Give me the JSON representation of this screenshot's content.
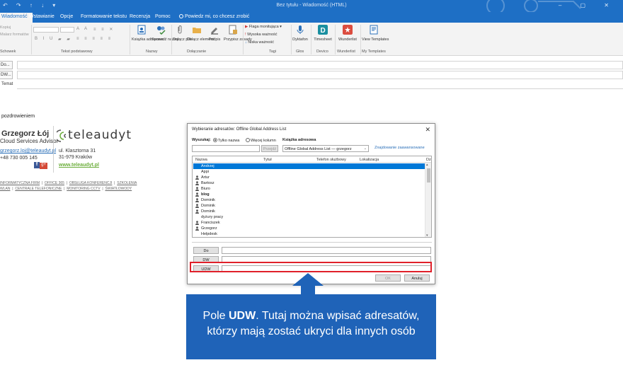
{
  "window": {
    "title": "Bez tytułu  -  Wiadomość (HTML)",
    "controls": "–  ▢  ✕"
  },
  "tabs": [
    {
      "label": "Wiadomość",
      "active": true
    },
    {
      "label": "Wstawianie"
    },
    {
      "label": "Opcje"
    },
    {
      "label": "Formatowanie tekstu"
    },
    {
      "label": "Recenzja"
    },
    {
      "label": "Pomoc"
    },
    {
      "label": "Powiedz mi, co chcesz zrobić"
    }
  ],
  "ribbon": {
    "clipboard_items": [
      "Kopiuj",
      "Malarz formatów"
    ],
    "group_labels": {
      "clipboard": "Schowek",
      "basic_text": "Tekst podstawowy",
      "names": "Nazwy",
      "include": "Dołączanie",
      "tags": "Tagi",
      "voice": "Głos",
      "devico": "Devico",
      "wunderlist": "Wunderlist",
      "templates": "My Templates"
    },
    "buttons": {
      "address_book": "Książka adresowa",
      "check_names": "Sprawdź nazwy",
      "attach_file": "Dołącz plik",
      "attach_item": "Dołącz element",
      "signature": "Podpis",
      "assign_policy": "Przypisz zasady",
      "dictate": "Dyktafon",
      "timesheet": "Timesheet",
      "wunderlist": "Wunderlist",
      "view_templates": "View Templates"
    },
    "tag_items": [
      "Flaga monitująca",
      "Wysoka ważność",
      "Niska ważność"
    ]
  },
  "header": {
    "to_label": "Do...",
    "cc_label": "DW...",
    "subject_label": "Temat"
  },
  "body": {
    "greeting": "pozdrowieniem"
  },
  "signature": {
    "name": "Grzegorz Łój",
    "role": "Cloud Services Advisor",
    "email": "grzegorz.loj@teleaudyt.pl",
    "phone": "+48 730 005 145",
    "social": [
      "f",
      "g+"
    ],
    "logo_text": "teleaudyt",
    "address_line1": "ul. Klasztorna 31",
    "address_line2": "31-979 Kraków",
    "website": "www.teleaudyt.pl",
    "links_line1": [
      "INFORMATYCZNA FIRM",
      "OFFICE 365",
      "OBSŁUGA KONFERENCJI",
      "SZKOLENIA"
    ],
    "links_line2": [
      "WLAN",
      "CENTRALE TELEFONICZNE",
      "MONITORING CCTV",
      "ŚWIATŁOWODY"
    ]
  },
  "dialog": {
    "title": "Wybieranie adresatów: Offline Global Address List",
    "search_label": "Wyszukaj:",
    "radio_name_only": "Tylko nazwa",
    "radio_more_columns": "Więcej kolumn",
    "address_book_label": "Książka adresowa",
    "go_button": "Przejdź",
    "address_book_selected": "Offline Global Address List — grzegorz",
    "advanced_link": "Znajdowanie zaawansowane",
    "columns": [
      "Nazwa",
      "Tytuł",
      "Telefon służbowy",
      "Lokalizacja",
      "Dz"
    ],
    "rows": [
      {
        "name": "Andrzej",
        "selected": true,
        "person": false
      },
      {
        "name": "Appi",
        "person": false
      },
      {
        "name": "Artur",
        "person": true
      },
      {
        "name": "Bartosz",
        "person": true
      },
      {
        "name": "Biuro",
        "person": true
      },
      {
        "name": "blog",
        "person": true,
        "bold": true
      },
      {
        "name": "Dominik",
        "person": true
      },
      {
        "name": "Dominik",
        "person": true
      },
      {
        "name": "Dominik",
        "person": true
      },
      {
        "name": "dyżury pracy",
        "person": false
      },
      {
        "name": "Franciszek",
        "person": true
      },
      {
        "name": "Grzegorz",
        "person": true
      },
      {
        "name": "Helpdesk",
        "person": false
      }
    ],
    "recipient_buttons": [
      "Do",
      "DW",
      "UDW"
    ],
    "ok_button": "OK",
    "cancel_button": "Anuluj"
  },
  "callout": {
    "line1_pre": "Pole ",
    "line1_bold": "UDW",
    "line1_post": ". Tutaj można wpisać adresatów,",
    "line2": "którzy mają zostać ukryci dla innych osób"
  },
  "colors": {
    "accent": "#1e6fc5",
    "callout_bg": "#1f63b8",
    "highlight_red": "#e0202a",
    "selection": "#0078d7"
  }
}
